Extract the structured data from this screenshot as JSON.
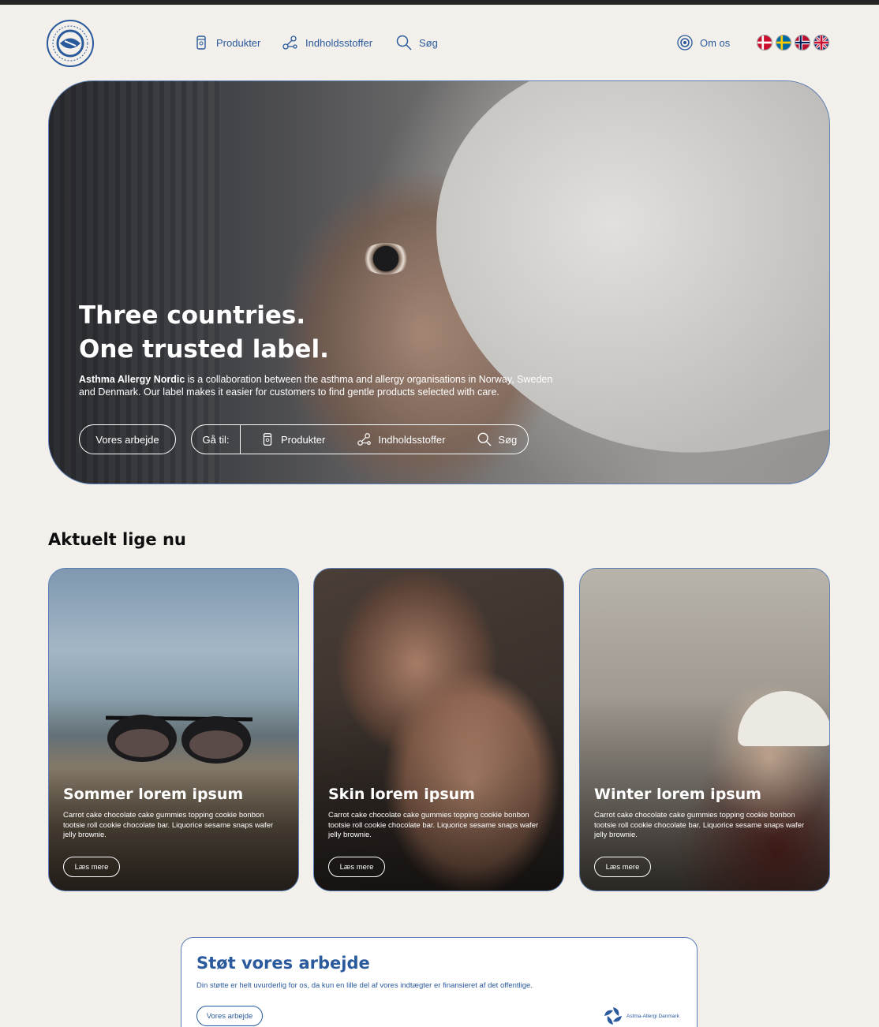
{
  "header": {
    "logo_text_top": "ASTHMA ALLERGY NORDIC",
    "logo_text_bottom": "SELECTED WITH CARE",
    "nav": [
      {
        "label": "Produkter",
        "icon": "tube-icon"
      },
      {
        "label": "Indholdsstoffer",
        "icon": "molecule-icon"
      },
      {
        "label": "Søg",
        "icon": "search-icon"
      }
    ],
    "about_label": "Om os",
    "flags": [
      "denmark-flag",
      "sweden-flag",
      "norway-flag",
      "uk-flag"
    ]
  },
  "hero": {
    "title_line1": "Three countries.",
    "title_line2": "One trusted label.",
    "desc_brand": "Asthma Allergy Nordic",
    "desc_rest": " is a collaboration between the asthma and allergy organisations in Norway, Sweden and Denmark. Our label makes it easier for customers to find gentle products selected with care.",
    "button_label": "Vores arbejde",
    "goto_label": "Gå til:",
    "goto_items": [
      "Produkter",
      "Indholdsstoffer",
      "Søg"
    ]
  },
  "news": {
    "title": "Aktuelt lige nu",
    "cards": [
      {
        "title": "Sommer lorem ipsum",
        "text": "Carrot cake chocolate cake gummies topping cookie bonbon tootsie roll cookie chocolate bar. Liquorice sesame snaps wafer jelly brownie.",
        "button": "Læs mere"
      },
      {
        "title": "Skin lorem ipsum",
        "text": "Carrot cake chocolate cake gummies topping cookie bonbon tootsie roll cookie chocolate bar. Liquorice sesame snaps wafer jelly brownie.",
        "button": "Læs mere"
      },
      {
        "title": "Winter lorem ipsum",
        "text": "Carrot cake chocolate cake gummies topping cookie bonbon tootsie roll cookie chocolate bar. Liquorice sesame snaps wafer jelly brownie.",
        "button": "Læs mere"
      }
    ]
  },
  "support": {
    "title": "Støt vores arbejde",
    "text": "Din støtte er helt uvurderlig for os, da kun en lille del af vores indtægter er finansieret af det offentlige.",
    "button": "Vores arbejde",
    "partner_logo_text": "Astma-Allergi Danmark"
  },
  "colors": {
    "background": "#f3f0eb",
    "brand_blue": "#2a5a9c",
    "outline": "#5b7fb4"
  }
}
